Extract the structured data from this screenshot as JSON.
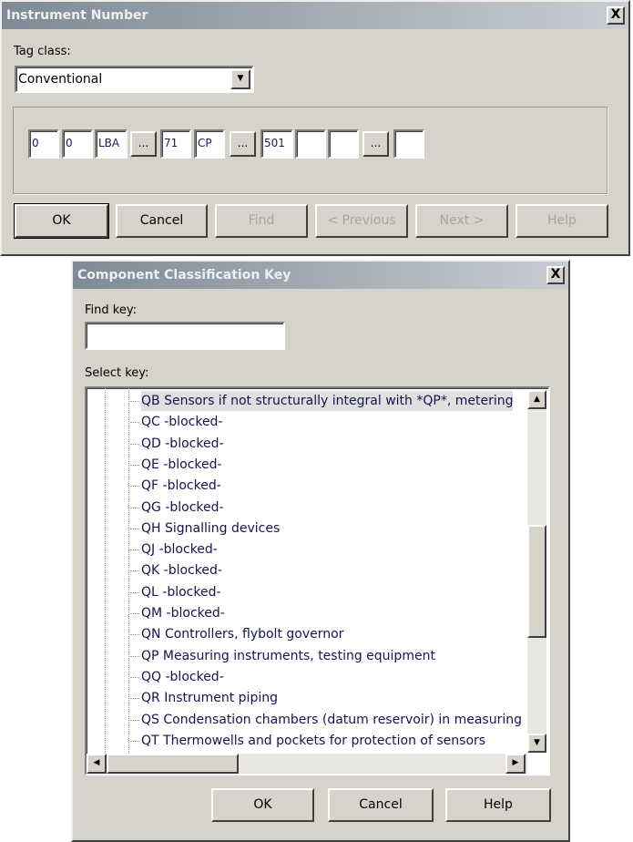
{
  "instrument_dialog": {
    "title": "Instrument Number",
    "tag_class_label": "Tag class:",
    "tag_class_value": "Conventional",
    "fields": [
      "0",
      "0",
      "LBA",
      "71",
      "CP",
      "501",
      "",
      "",
      ""
    ],
    "browse_label": "...",
    "buttons": {
      "ok": "OK",
      "cancel": "Cancel",
      "find": "Find",
      "previous": "< Previous",
      "next": "Next >",
      "help": "Help"
    },
    "close": "X"
  },
  "key_dialog": {
    "title": "Component Classification Key",
    "find_key_label": "Find key:",
    "find_key_value": "",
    "select_key_label": "Select key:",
    "items": [
      "QB Sensors if not structurally integral with *QP*, metering",
      "QC -blocked-",
      "QD -blocked-",
      "QE -blocked-",
      "QF -blocked-",
      "QG -blocked-",
      "QH Signalling devices",
      "QJ -blocked-",
      "QK -blocked-",
      "QL -blocked-",
      "QM -blocked-",
      "QN Controllers, flybolt governor",
      "QP Measuring instruments, testing equipment",
      "QQ -blocked-",
      "QR Instrument piping",
      "QS Condensation chambers (datum reservoir) in measuring",
      "QT Thermowells and pockets for protection of sensors"
    ],
    "selected_index": 0,
    "buttons": {
      "ok": "OK",
      "cancel": "Cancel",
      "help": "Help"
    },
    "close": "X"
  }
}
